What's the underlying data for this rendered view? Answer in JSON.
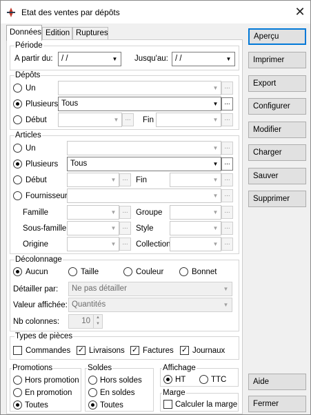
{
  "window": {
    "title": "Etat des ventes par dépôts",
    "close_glyph": "✕"
  },
  "tabs": [
    "Données",
    "Edition",
    "Ruptures"
  ],
  "periode": {
    "title": "Période",
    "from_label": "A partir du:",
    "from_value": " /  /",
    "to_label": "Jusqu'au:",
    "to_value": " /  /"
  },
  "depots": {
    "title": "Dépôts",
    "un_label": "Un",
    "plusieurs_label": "Plusieurs",
    "plusieurs_value": "Tous",
    "debut_label": "Début",
    "fin_label": "Fin"
  },
  "articles": {
    "title": "Articles",
    "un_label": "Un",
    "plusieurs_label": "Plusieurs",
    "plusieurs_value": "Tous",
    "debut_label": "Début",
    "fin_label": "Fin",
    "fournisseur_label": "Fournisseur",
    "famille_label": "Famille",
    "groupe_label": "Groupe",
    "sousfamille_label": "Sous-famille",
    "style_label": "Style",
    "origine_label": "Origine",
    "collection_label": "Collection"
  },
  "decolonnage": {
    "title": "Décolonnage",
    "options": [
      "Aucun",
      "Taille",
      "Couleur",
      "Bonnet"
    ],
    "selected": "Aucun",
    "detail_label": "Détailler par:",
    "detail_value": "Ne pas détailler",
    "valeur_label": "Valeur affichée:",
    "valeur_value": "Quantités",
    "nbcol_label": "Nb colonnes:",
    "nbcol_value": "10"
  },
  "types": {
    "title": "Types de pièces",
    "items": [
      {
        "label": "Commandes",
        "checked": false
      },
      {
        "label": "Livraisons",
        "checked": true
      },
      {
        "label": "Factures",
        "checked": true
      },
      {
        "label": "Journaux",
        "checked": true
      }
    ]
  },
  "promotions": {
    "title": "Promotions",
    "options": [
      "Hors promotion",
      "En promotion",
      "Toutes"
    ],
    "selected": "Toutes"
  },
  "soldes": {
    "title": "Soldes",
    "options": [
      "Hors soldes",
      "En soldes",
      "Toutes"
    ],
    "selected": "Toutes"
  },
  "affichage": {
    "title": "Affichage",
    "options": [
      "HT",
      "TTC"
    ],
    "selected": "HT"
  },
  "marge": {
    "title": "Marge",
    "calc_label": "Calculer la marge",
    "checked": false
  },
  "buttons": {
    "apercu": "Aperçu",
    "imprimer": "Imprimer",
    "export": "Export",
    "configurer": "Configurer",
    "modifier": "Modifier",
    "charger": "Charger",
    "sauver": "Sauver",
    "supprimer": "Supprimer",
    "aide": "Aide",
    "fermer": "Fermer"
  },
  "glyphs": {
    "dropdown": "▼",
    "ellipsis": "...",
    "check": "✓",
    "spin_up": "▲",
    "spin_down": "▼"
  }
}
